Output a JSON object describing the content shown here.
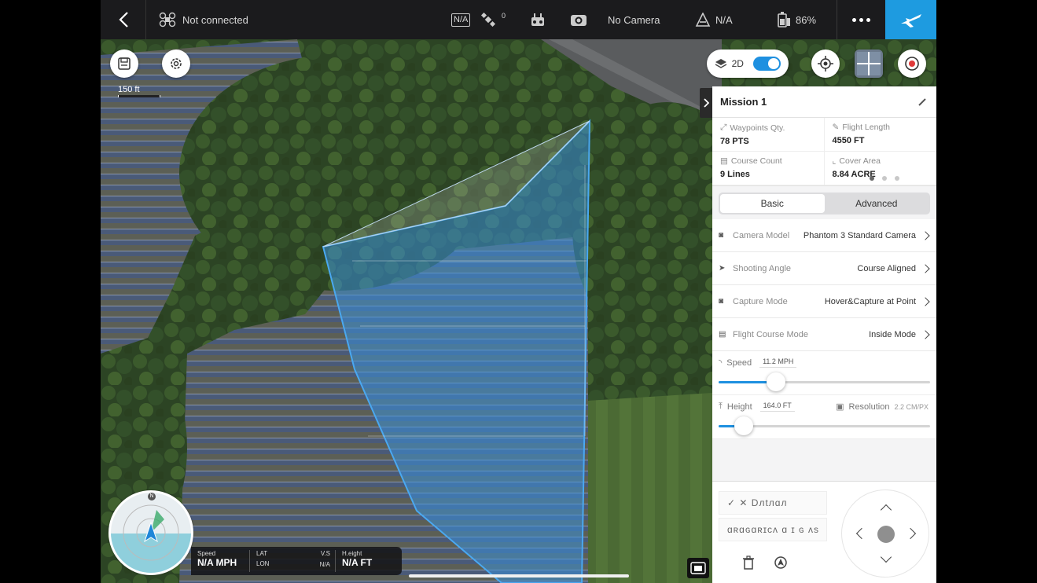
{
  "topbar": {
    "connection": "Not connected",
    "gps_label": "N/A",
    "satellites": "0",
    "camera": "No Camera",
    "signal": "N/A",
    "battery": "86%"
  },
  "map": {
    "scale_label": "150 ft",
    "view_mode": "2D",
    "view_toggle_on": true
  },
  "mission": {
    "name": "Mission 1",
    "stats": [
      {
        "label": "Waypoints Qty.",
        "value": "78 PTS"
      },
      {
        "label": "Flight Length",
        "value": "4550 FT"
      },
      {
        "label": "Course Count",
        "value": "9 Lines"
      },
      {
        "label": "Cover Area",
        "value": "8.84 ACRE"
      }
    ],
    "tabs": [
      "Basic",
      "Advanced"
    ],
    "settings": [
      {
        "label": "Camera Model",
        "value": "Phantom 3 Standard Camera"
      },
      {
        "label": "Shooting Angle",
        "value": "Course Aligned"
      },
      {
        "label": "Capture Mode",
        "value": "Hover&Capture at Point"
      },
      {
        "label": "Flight Course Mode",
        "value": "Inside Mode"
      }
    ],
    "speed": {
      "label": "Speed",
      "value": "11.2 MPH",
      "level": 0.27
    },
    "height": {
      "label": "Height",
      "value": "164.0 FT",
      "level": 0.12
    },
    "resolution": {
      "label": "Resolution",
      "value": "2.2 CM/PX"
    },
    "bottom_lines": [
      "✓ ✕ Dлtлɑл",
      "ɑʀɑɢɑʀɪcʌ ɑ ɪ ɢ ʌs"
    ]
  },
  "telemetry": {
    "compass_n": "N",
    "speed_label": "Speed",
    "speed_value": "N/A MPH",
    "lat_label": "LAT",
    "lon_label": "LON",
    "vs_label": "V.S",
    "vs_value": "N/A",
    "height_label": "H.eight",
    "height_value": "N/A FT"
  },
  "colors": {
    "accent": "#1e9be0",
    "polygon": "#3a8fd8",
    "topbar": "#1b1b1d"
  }
}
